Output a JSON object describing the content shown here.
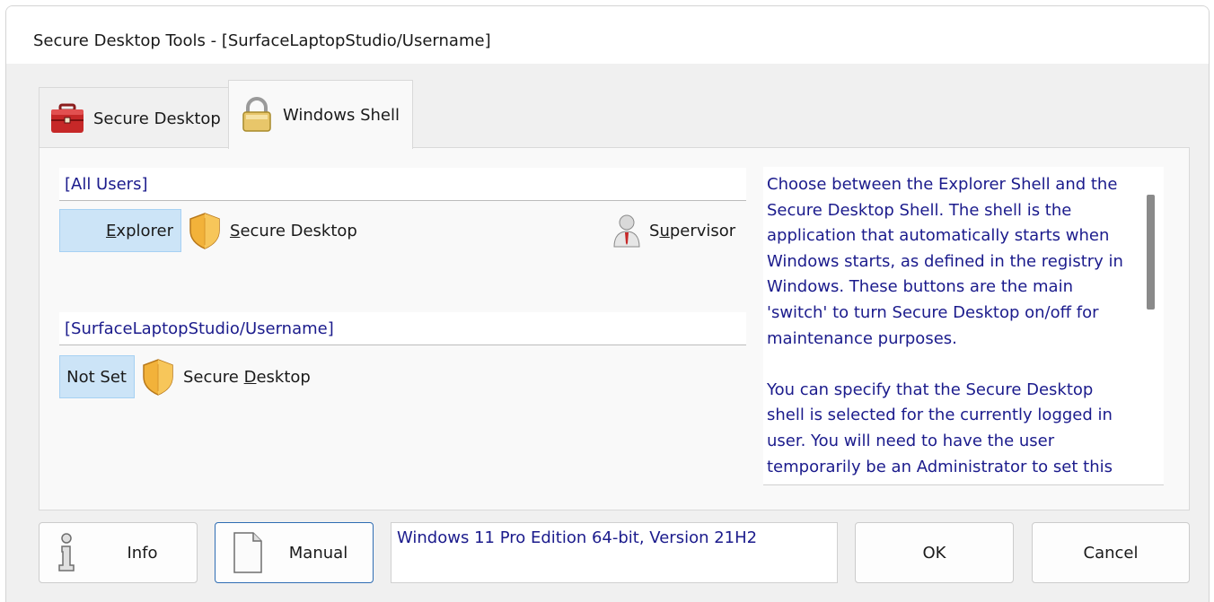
{
  "window": {
    "title": "Secure Desktop Tools - [SurfaceLaptopStudio/Username]"
  },
  "tabs": [
    {
      "label": "Secure Desktop",
      "icon": "toolbox-icon",
      "active": false
    },
    {
      "label": "Windows Shell",
      "icon": "padlock-icon",
      "active": true
    }
  ],
  "all_users": {
    "header": "[All Users]",
    "explorer_label": "Explorer",
    "secure_desktop_label": "Secure Desktop",
    "supervisor_label": "Supervisor"
  },
  "user": {
    "header": "[SurfaceLaptopStudio/Username]",
    "not_set_label": "Not Set",
    "secure_desktop_label": "Secure Desktop"
  },
  "help": {
    "paragraph1": "Choose between the Explorer Shell and the Secure Desktop Shell. The shell is the application that automatically starts when Windows starts, as defined in the registry in Windows. These buttons are the main 'switch' to turn Secure Desktop on/off for maintenance purposes.",
    "paragraph2": "You can specify that the Secure Desktop shell is selected for the currently logged in user. You will need to have the user temporarily be an Administrator to set this"
  },
  "footer": {
    "info_label": "Info",
    "manual_label": "Manual",
    "version_text": "Windows 11 Pro Edition 64-bit, Version 21H2",
    "ok_label": "OK",
    "cancel_label": "Cancel"
  },
  "colors": {
    "selected_button": "#cce4f7",
    "text_blue": "#1b1b8c",
    "window_bg": "#f0f0f0"
  }
}
